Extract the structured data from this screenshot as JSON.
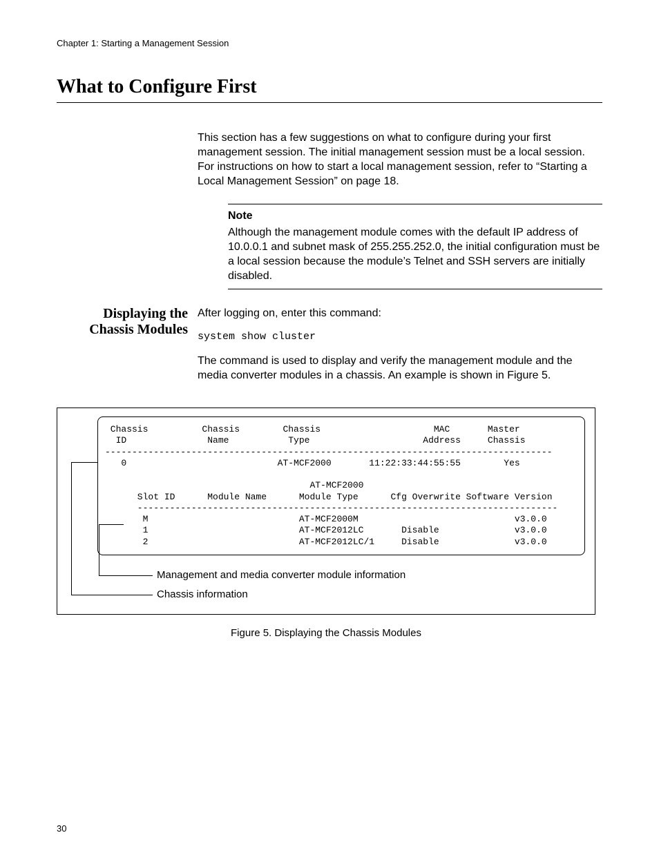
{
  "header": {
    "chapter": "Chapter 1: Starting a Management Session"
  },
  "title": "What to Configure First",
  "intro": "This section has a few suggestions on what to configure during your first management session. The initial management session must be a local session. For instructions on how to start a local management session, refer to “Starting a Local Management Session” on page 18.",
  "note": {
    "label": "Note",
    "body": "Although the management module comes with the default IP address of 10.0.0.1 and subnet mask of 255.255.252.0, the initial configuration must be a local session because the module’s Telnet and SSH servers are initially disabled."
  },
  "subsection": {
    "heading_l1": "Displaying the",
    "heading_l2": "Chassis Modules",
    "cmd_intro": "After logging on, enter this command:",
    "command": "system show cluster",
    "desc": "The command is used to display and verify the management module and the media converter modules in a chassis. An example is shown in Figure 5."
  },
  "figure": {
    "cli": " Chassis          Chassis        Chassis                     MAC       Master\n  ID               Name           Type                     Address     Chassis\n-----------------------------------------------------------------------------------\n   0                            AT-MCF2000       11:22:33:44:55:55        Yes\n\n                                      AT-MCF2000\n      Slot ID      Module Name      Module Type      Cfg Overwrite Software Version\n      ------------------------------------------------------------------------------\n       M                            AT-MCF2000M                             v3.0.0\n       1                            AT-MCF2012LC       Disable              v3.0.0\n       2                            AT-MCF2012LC/1     Disable              v3.0.0",
    "callout1": "Management and media converter module information",
    "callout2": "Chassis information",
    "caption": "Figure 5. Displaying the Chassis Modules"
  },
  "pagenum": "30"
}
